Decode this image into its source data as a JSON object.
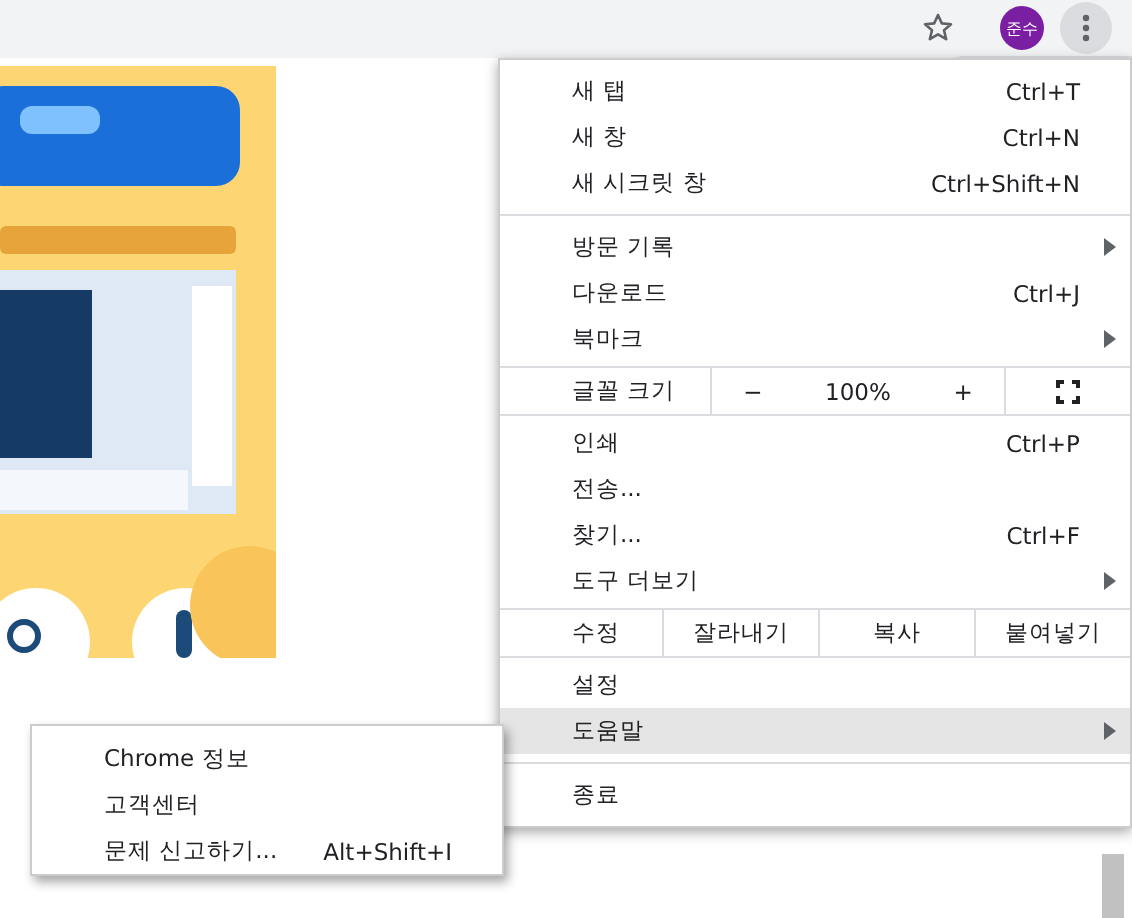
{
  "toolbar": {
    "avatar": "준수"
  },
  "menu": [
    {
      "kind": "item",
      "label": "새 탭",
      "shortcut": "Ctrl+T",
      "has_submenu": false,
      "selected": false
    },
    {
      "kind": "item",
      "label": "새 창",
      "shortcut": "Ctrl+N",
      "has_submenu": false,
      "selected": false
    },
    {
      "kind": "item",
      "label": "새 시크릿 창",
      "shortcut": "Ctrl+Shift+N",
      "has_submenu": false,
      "selected": false
    },
    {
      "kind": "separator"
    },
    {
      "kind": "item",
      "label": "방문 기록",
      "has_submenu": true,
      "selected": false
    },
    {
      "kind": "item",
      "label": "다운로드",
      "shortcut": "Ctrl+J",
      "has_submenu": false,
      "selected": false
    },
    {
      "kind": "item",
      "label": "북마크",
      "has_submenu": true,
      "selected": false
    },
    {
      "kind": "zoom",
      "label": "글꼴 크기",
      "minus": "−",
      "value": "100%",
      "plus": "+"
    },
    {
      "kind": "item",
      "label": "인쇄",
      "shortcut": "Ctrl+P",
      "has_submenu": false,
      "selected": false
    },
    {
      "kind": "item",
      "label": "전송...",
      "has_submenu": false,
      "selected": false
    },
    {
      "kind": "item",
      "label": "찾기...",
      "shortcut": "Ctrl+F",
      "has_submenu": false,
      "selected": false
    },
    {
      "kind": "item",
      "label": "도구 더보기",
      "has_submenu": true,
      "selected": false
    },
    {
      "kind": "edit",
      "label": "수정",
      "actions": [
        "잘라내기",
        "복사",
        "붙여넣기"
      ]
    },
    {
      "kind": "item",
      "label": "설정",
      "has_submenu": false,
      "selected": false
    },
    {
      "kind": "item",
      "label": "도움말",
      "has_submenu": true,
      "selected": true
    },
    {
      "kind": "separator"
    },
    {
      "kind": "item",
      "label": "종료",
      "has_submenu": false,
      "selected": false
    }
  ],
  "submenu": [
    {
      "label": "Chrome 정보"
    },
    {
      "label": "고객센터"
    },
    {
      "label": "문제 신고하기...",
      "shortcut": "Alt+Shift+I"
    }
  ]
}
